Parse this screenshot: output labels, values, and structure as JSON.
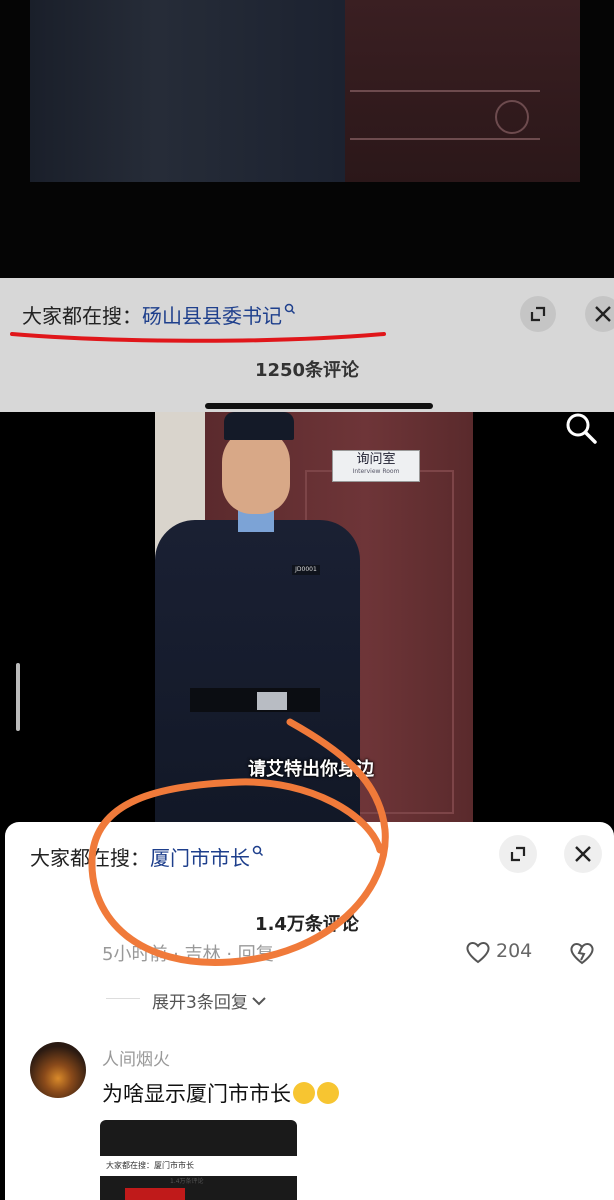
{
  "top_panel": {
    "search_prefix": "大家都在搜：",
    "search_keyword": "砀山县县委书记",
    "comment_count": "1250条评论"
  },
  "video": {
    "door_sign": "询问室",
    "door_sign_en": "Interview Room",
    "badge_number": "JD0001",
    "subtitle": "请艾特出你身边"
  },
  "bottom_panel": {
    "search_prefix": "大家都在搜：",
    "search_keyword": "厦门市市长",
    "comment_count": "1.4万条评论",
    "meta": "5小时前 · 吉林 · 回复",
    "like_count": "204",
    "expand_replies": "展开3条回复",
    "comment": {
      "username": "人间烟火",
      "text": "为啥显示厦门市市长"
    },
    "thumbnail": {
      "search_text": "大家都在搜：厦门市市长",
      "comment_count": "1.4万条评论"
    }
  },
  "annotations": {
    "underline_color": "#e0161a",
    "circle_color": "#f07a3a"
  },
  "icons": [
    "search-hint-icon",
    "expand-icon",
    "close-icon",
    "search-icon",
    "like-heart-icon",
    "dislike-icon",
    "chevron-down-icon",
    "laugh-cry-emoji"
  ]
}
